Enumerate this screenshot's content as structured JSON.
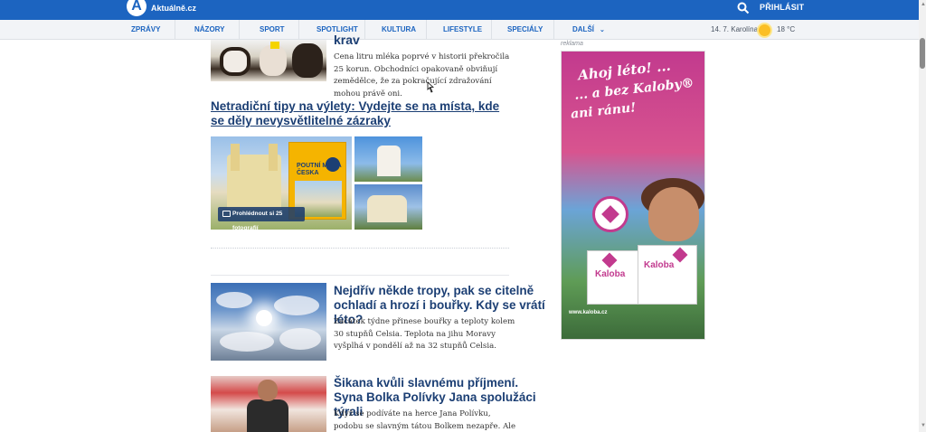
{
  "header": {
    "logo_letter": "A",
    "site_name": "Aktuálně.cz",
    "login_label": "PŘIHLÁSIT",
    "search_icon": "search-icon",
    "brand_color": "#1c64c0"
  },
  "nav": {
    "items": [
      "ZPRÁVY",
      "NÁZORY",
      "SPORT",
      "SPOTLIGHT",
      "KULTURA",
      "LIFESTYLE",
      "SPECIÁLY",
      "DALŠÍ"
    ],
    "more_chevron": "⌄",
    "date": "14. 7. Karolína",
    "weather_icon": "sun-icon",
    "temperature": "18 °C"
  },
  "articles": [
    {
      "title": "krav",
      "perex": "Cena litru mléka poprvé v historii překročila 25 korun. Obchodníci opakovaně obviňují zemědělce, že za pokračující zdražování mohou právě oni."
    },
    {
      "title": "Netradiční tipy na výlety: Vydejte se na místa, kde se děly nevysvětlitelné zázraky",
      "gallery_button": "Prohlédnout si 25 fotografií",
      "book_title": "POUTNÍ MÍSTA ČESKA"
    },
    {
      "title": "Nejdřív něk­de tropy, pak se citelně ochladí a hrozí i bouřky. Kdy se vrátí léto?",
      "perex": "Začátek týdne přinese bouřky a teploty kolem 30 stupňů Celsia. Teplota na jihu Moravy vyšplhá v pondělí až na 32 stupňů Celsia."
    },
    {
      "title": "Šikana kvůli slavnému příjmení. Syna Bolka Polívky Jana spolužáci týrali",
      "perex": "Když se podíváte na herce Jana Polívku, podobu se slavným tátou Bolkem nezapře. Ale byly doby, kdy"
    }
  ],
  "ad": {
    "label": "reklama",
    "line1": "Ahoj léto! ...",
    "line2": "... a bez Kaloby®",
    "line3": "ani ránu!",
    "brand": "Kaloba",
    "url": "www.kaloba.cz"
  }
}
